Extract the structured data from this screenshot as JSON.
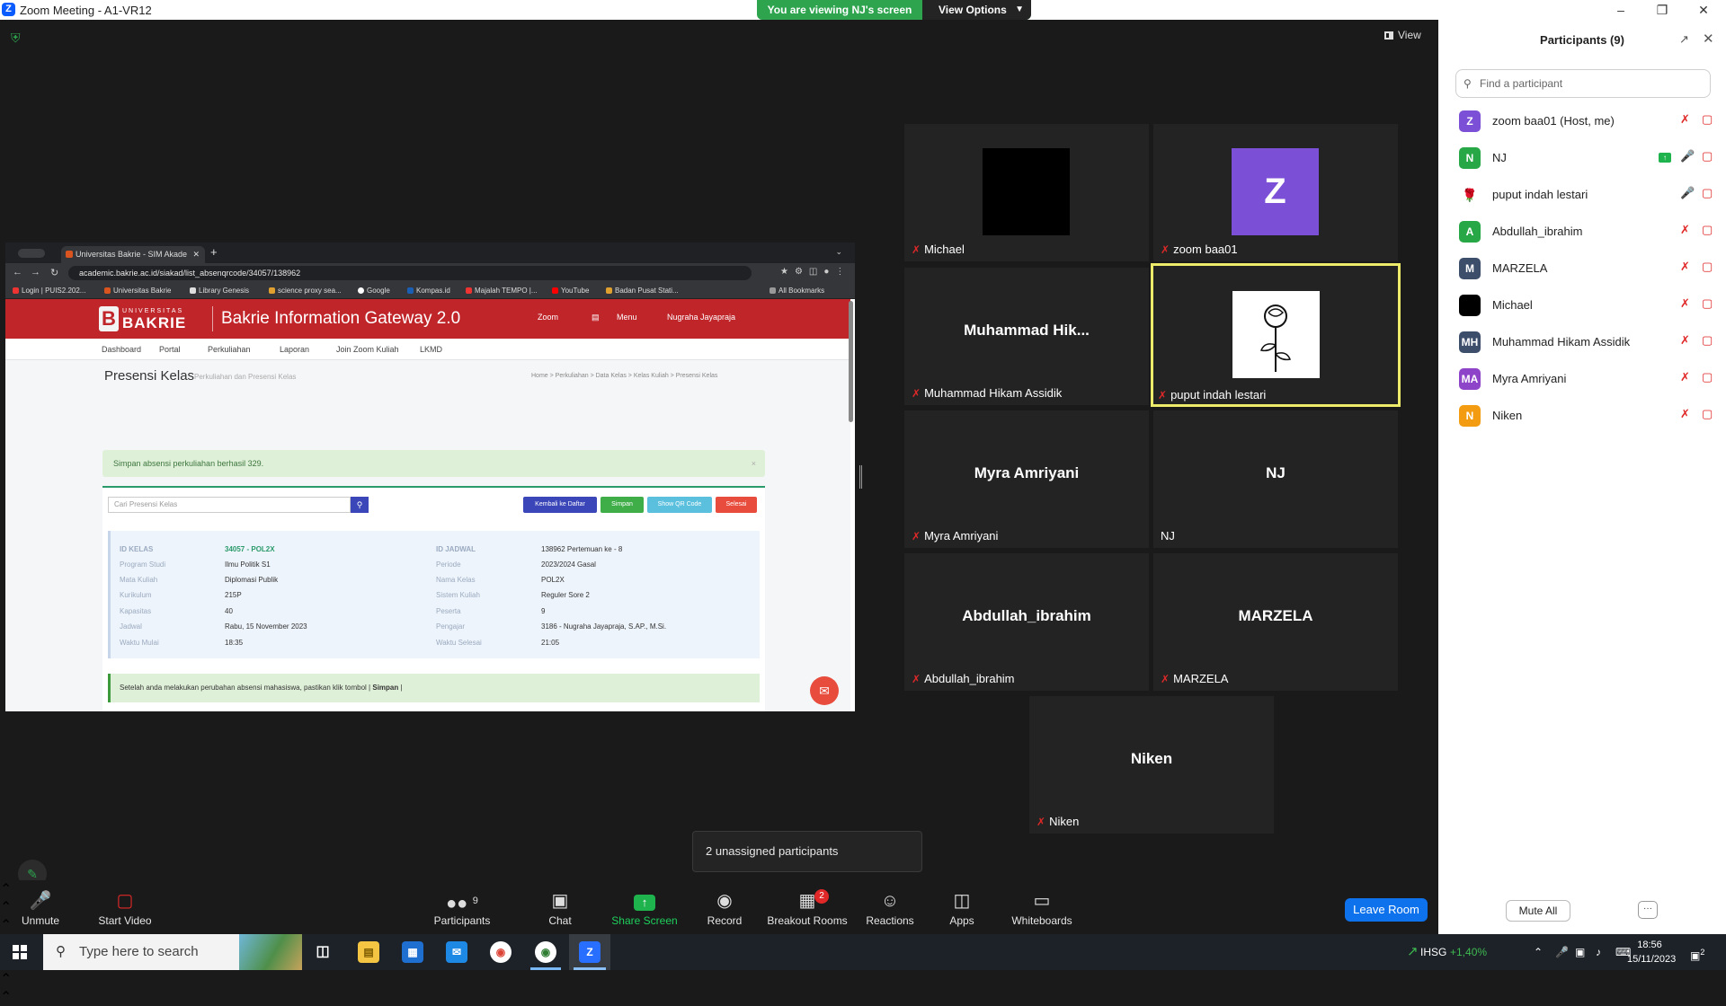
{
  "window": {
    "title": "Zoom Meeting - A1-VR12",
    "viewing_banner": "You are viewing NJ's screen",
    "view_options": "View Options"
  },
  "meeting": {
    "view_label": "View",
    "unassigned_tooltip": "2 unassigned participants"
  },
  "shared_browser": {
    "tab_title": "Universitas Bakrie - SIM Akade",
    "url": "academic.bakrie.ac.id/siakad/list_absenqrcode/34057/138962",
    "bookmarks": [
      "Login | PUIS2.202...",
      "Universitas Bakrie",
      "Library Genesis",
      "science proxy sea...",
      "Google",
      "Kompas.id",
      "Majalah TEMPO |...",
      "YouTube",
      "Badan Pusat Stati..."
    ],
    "all_bookmarks": "All Bookmarks",
    "site": {
      "logo_top": "UNIVERSITAS",
      "logo_main": "BAKRIE",
      "gateway": "Bakrie Information Gateway 2.0",
      "head_links": [
        "Zoom",
        "Menu",
        "Nugraha Jayapraja"
      ],
      "nav": [
        "Dashboard",
        "Portal",
        "Perkuliahan",
        "Laporan",
        "Join Zoom Kuliah",
        "LKMD"
      ],
      "page_title": "Presensi Kelas",
      "page_subtitle": "Perkuliahan dan Presensi Kelas",
      "breadcrumb": "Home  >  Perkuliahan  >  Data Kelas  >  Kelas Kuliah  >  Presensi Kelas",
      "success_alert": "Simpan absensi perkuliahan berhasil 329.",
      "search_placeholder": "Cari Presensi Kelas",
      "buttons": [
        "Kembali ke Daftar",
        "Simpan",
        "Show QR Code",
        "Selesai"
      ],
      "info_left": [
        {
          "label": "ID KELAS",
          "value": "34057 - POL2X"
        },
        {
          "label": "Program Studi",
          "value": "Ilmu Politik S1"
        },
        {
          "label": "Mata Kuliah",
          "value": "Diplomasi Publik"
        },
        {
          "label": "Kurikulum",
          "value": "215P"
        },
        {
          "label": "Kapasitas",
          "value": "40"
        },
        {
          "label": "Jadwal",
          "value": "Rabu, 15 November 2023"
        },
        {
          "label": "Waktu Mulai",
          "value": "18:35"
        }
      ],
      "info_right": [
        {
          "label": "ID JADWAL",
          "value": "138962 Pertemuan ke - 8"
        },
        {
          "label": "Periode",
          "value": "2023/2024 Gasal"
        },
        {
          "label": "Nama Kelas",
          "value": "POL2X"
        },
        {
          "label": "Sistem Kuliah",
          "value": "Reguler Sore 2"
        },
        {
          "label": "Peserta",
          "value": "9"
        },
        {
          "label": "Pengajar",
          "value": "3186 - Nugraha Jayapraja, S.AP., M.Si."
        },
        {
          "label": "Waktu Selesai",
          "value": "21:05"
        }
      ],
      "save_note": "Setelah anda melakukan perubahan absensi mahasiswa, pastikan klik tombol |",
      "save_note_strong": "Simpan",
      "save_note_end": "|"
    }
  },
  "gallery": [
    {
      "name": "Michael",
      "big": "",
      "avatar": "black"
    },
    {
      "name": "zoom baa01",
      "big": "",
      "avatar": "Z"
    },
    {
      "name": "Muhammad Hikam Assidik",
      "big": "Muhammad  Hik..."
    },
    {
      "name": "puput indah lestari",
      "big": "",
      "avatar": "image",
      "active": true
    },
    {
      "name": "Myra Amriyani",
      "big": "Myra Amriyani"
    },
    {
      "name": "NJ",
      "big": "NJ"
    },
    {
      "name": "Abdullah_ibrahim",
      "big": "Abdullah_ibrahim"
    },
    {
      "name": "MARZELA",
      "big": "MARZELA"
    },
    {
      "name": "Niken",
      "big": "Niken"
    }
  ],
  "toolbar": {
    "unmute": "Unmute",
    "start_video": "Start Video",
    "participants": "Participants",
    "participants_count": "9",
    "chat": "Chat",
    "share_screen": "Share Screen",
    "record": "Record",
    "breakout_rooms": "Breakout Rooms",
    "breakout_badge": "2",
    "reactions": "Reactions",
    "apps": "Apps",
    "whiteboards": "Whiteboards",
    "leave_room": "Leave Room"
  },
  "participants_panel": {
    "title": "Participants (9)",
    "search_placeholder": "Find a participant",
    "mute_all": "Mute All",
    "more": "···",
    "list": [
      {
        "initials": "Z",
        "name": "zoom baa01 (Host, me)",
        "color": "#7b4fd6"
      },
      {
        "initials": "N",
        "name": "NJ",
        "color": "#27a745",
        "sharing": true
      },
      {
        "initials": "",
        "name": "puput indah lestari",
        "color": "#ffffff"
      },
      {
        "initials": "A",
        "name": "Abdullah_ibrahim",
        "color": "#27a745"
      },
      {
        "initials": "M",
        "name": "MARZELA",
        "color": "#3d4e6b"
      },
      {
        "initials": "",
        "name": "Michael",
        "color": "#000000"
      },
      {
        "initials": "MH",
        "name": "Muhammad Hikam Assidik",
        "color": "#3d4e6b"
      },
      {
        "initials": "MA",
        "name": "Myra Amriyani",
        "color": "#8e44c9"
      },
      {
        "initials": "N",
        "name": "Niken",
        "color": "#f39c12"
      }
    ]
  },
  "taskbar": {
    "search_placeholder": "Type here to search",
    "stock_name": "IHSG",
    "stock_change": "+1,40%",
    "time": "18:56",
    "date": "15/11/2023",
    "notification_count": "2"
  }
}
